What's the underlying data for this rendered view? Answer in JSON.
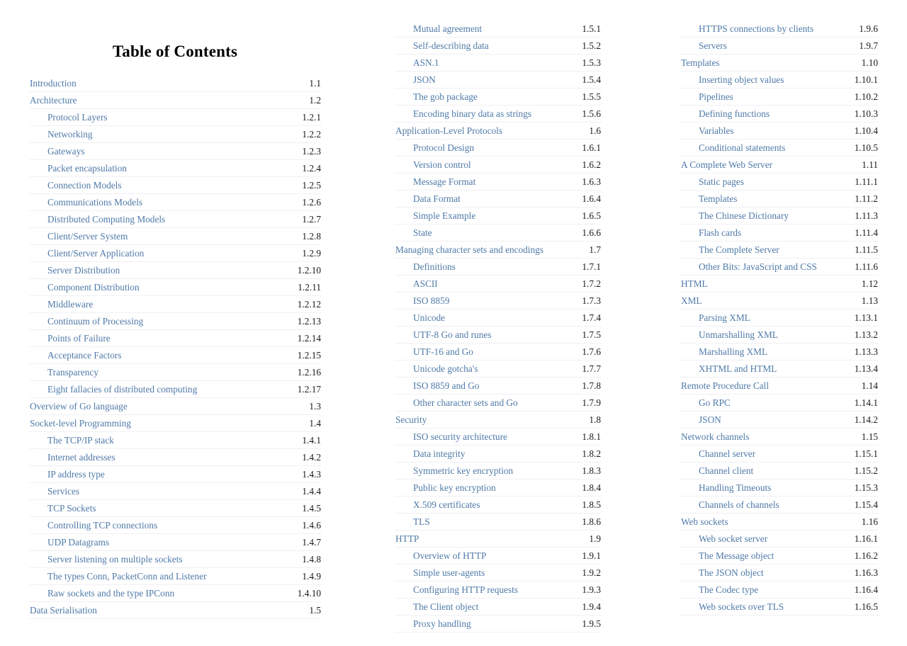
{
  "page": {
    "title": "Table of Contents",
    "link_color": "#4f7aa8",
    "number_color": "#1a1a1a",
    "rule_color": "#f1f1f4",
    "background": "#ffffff"
  },
  "columns": [
    {
      "id": "column-1",
      "has_title": true,
      "entries": [
        {
          "label": "Introduction",
          "number": "1.1",
          "level": 1
        },
        {
          "label": "Architecture",
          "number": "1.2",
          "level": 1
        },
        {
          "label": "Protocol Layers",
          "number": "1.2.1",
          "level": 2
        },
        {
          "label": "Networking",
          "number": "1.2.2",
          "level": 2
        },
        {
          "label": "Gateways",
          "number": "1.2.3",
          "level": 2
        },
        {
          "label": "Packet encapsulation",
          "number": "1.2.4",
          "level": 2
        },
        {
          "label": "Connection Models",
          "number": "1.2.5",
          "level": 2
        },
        {
          "label": "Communications Models",
          "number": "1.2.6",
          "level": 2
        },
        {
          "label": "Distributed Computing Models",
          "number": "1.2.7",
          "level": 2
        },
        {
          "label": "Client/Server System",
          "number": "1.2.8",
          "level": 2
        },
        {
          "label": "Client/Server Application",
          "number": "1.2.9",
          "level": 2
        },
        {
          "label": "Server Distribution",
          "number": "1.2.10",
          "level": 2
        },
        {
          "label": "Component Distribution",
          "number": "1.2.11",
          "level": 2
        },
        {
          "label": "Middleware",
          "number": "1.2.12",
          "level": 2
        },
        {
          "label": "Continuum of Processing",
          "number": "1.2.13",
          "level": 2
        },
        {
          "label": "Points of Failure",
          "number": "1.2.14",
          "level": 2
        },
        {
          "label": "Acceptance Factors",
          "number": "1.2.15",
          "level": 2
        },
        {
          "label": "Transparency",
          "number": "1.2.16",
          "level": 2
        },
        {
          "label": "Eight fallacies of distributed computing",
          "number": "1.2.17",
          "level": 2
        },
        {
          "label": "Overview of Go language",
          "number": "1.3",
          "level": 1
        },
        {
          "label": "Socket-level Programming",
          "number": "1.4",
          "level": 1
        },
        {
          "label": "The TCP/IP stack",
          "number": "1.4.1",
          "level": 2
        },
        {
          "label": "Internet addresses",
          "number": "1.4.2",
          "level": 2
        },
        {
          "label": "IP address type",
          "number": "1.4.3",
          "level": 2
        },
        {
          "label": "Services",
          "number": "1.4.4",
          "level": 2
        },
        {
          "label": "TCP Sockets",
          "number": "1.4.5",
          "level": 2
        },
        {
          "label": "Controlling TCP connections",
          "number": "1.4.6",
          "level": 2
        },
        {
          "label": "UDP Datagrams",
          "number": "1.4.7",
          "level": 2
        },
        {
          "label": "Server listening on multiple sockets",
          "number": "1.4.8",
          "level": 2
        },
        {
          "label": "The types Conn, PacketConn and Listener",
          "number": "1.4.9",
          "level": 2
        },
        {
          "label": "Raw sockets and the type IPConn",
          "number": "1.4.10",
          "level": 2
        },
        {
          "label": "Data Serialisation",
          "number": "1.5",
          "level": 1
        }
      ]
    },
    {
      "id": "column-2",
      "has_title": false,
      "entries": [
        {
          "label": "Mutual agreement",
          "number": "1.5.1",
          "level": 2
        },
        {
          "label": "Self-describing data",
          "number": "1.5.2",
          "level": 2
        },
        {
          "label": "ASN.1",
          "number": "1.5.3",
          "level": 2
        },
        {
          "label": "JSON",
          "number": "1.5.4",
          "level": 2
        },
        {
          "label": "The gob package",
          "number": "1.5.5",
          "level": 2
        },
        {
          "label": "Encoding binary data as strings",
          "number": "1.5.6",
          "level": 2
        },
        {
          "label": "Application-Level Protocols",
          "number": "1.6",
          "level": 1
        },
        {
          "label": "Protocol Design",
          "number": "1.6.1",
          "level": 2
        },
        {
          "label": "Version control",
          "number": "1.6.2",
          "level": 2
        },
        {
          "label": "Message Format",
          "number": "1.6.3",
          "level": 2
        },
        {
          "label": "Data Format",
          "number": "1.6.4",
          "level": 2
        },
        {
          "label": "Simple Example",
          "number": "1.6.5",
          "level": 2
        },
        {
          "label": "State",
          "number": "1.6.6",
          "level": 2
        },
        {
          "label": "Managing character sets and encodings",
          "number": "1.7",
          "level": 1
        },
        {
          "label": "Definitions",
          "number": "1.7.1",
          "level": 2
        },
        {
          "label": "ASCII",
          "number": "1.7.2",
          "level": 2
        },
        {
          "label": "ISO 8859",
          "number": "1.7.3",
          "level": 2
        },
        {
          "label": "Unicode",
          "number": "1.7.4",
          "level": 2
        },
        {
          "label": "UTF-8 Go and runes",
          "number": "1.7.5",
          "level": 2
        },
        {
          "label": "UTF-16 and Go",
          "number": "1.7.6",
          "level": 2
        },
        {
          "label": "Unicode gotcha's",
          "number": "1.7.7",
          "level": 2
        },
        {
          "label": "ISO 8859 and Go",
          "number": "1.7.8",
          "level": 2
        },
        {
          "label": "Other character sets and Go",
          "number": "1.7.9",
          "level": 2
        },
        {
          "label": "Security",
          "number": "1.8",
          "level": 1
        },
        {
          "label": "ISO security architecture",
          "number": "1.8.1",
          "level": 2
        },
        {
          "label": "Data integrity",
          "number": "1.8.2",
          "level": 2
        },
        {
          "label": "Symmetric key encryption",
          "number": "1.8.3",
          "level": 2
        },
        {
          "label": "Public key encryption",
          "number": "1.8.4",
          "level": 2
        },
        {
          "label": "X.509 certificates",
          "number": "1.8.5",
          "level": 2
        },
        {
          "label": "TLS",
          "number": "1.8.6",
          "level": 2
        },
        {
          "label": "HTTP",
          "number": "1.9",
          "level": 1
        },
        {
          "label": "Overview of HTTP",
          "number": "1.9.1",
          "level": 2
        },
        {
          "label": "Simple user-agents",
          "number": "1.9.2",
          "level": 2
        },
        {
          "label": "Configuring HTTP requests",
          "number": "1.9.3",
          "level": 2
        },
        {
          "label": "The Client object",
          "number": "1.9.4",
          "level": 2
        },
        {
          "label": "Proxy handling",
          "number": "1.9.5",
          "level": 2
        }
      ]
    },
    {
      "id": "column-3",
      "has_title": false,
      "entries": [
        {
          "label": "HTTPS connections by clients",
          "number": "1.9.6",
          "level": 2
        },
        {
          "label": "Servers",
          "number": "1.9.7",
          "level": 2
        },
        {
          "label": "Templates",
          "number": "1.10",
          "level": 1
        },
        {
          "label": "Inserting object values",
          "number": "1.10.1",
          "level": 2
        },
        {
          "label": "Pipelines",
          "number": "1.10.2",
          "level": 2
        },
        {
          "label": "Defining functions",
          "number": "1.10.3",
          "level": 2
        },
        {
          "label": "Variables",
          "number": "1.10.4",
          "level": 2
        },
        {
          "label": "Conditional statements",
          "number": "1.10.5",
          "level": 2
        },
        {
          "label": "A Complete Web Server",
          "number": "1.11",
          "level": 1
        },
        {
          "label": "Static pages",
          "number": "1.11.1",
          "level": 2
        },
        {
          "label": "Templates",
          "number": "1.11.2",
          "level": 2
        },
        {
          "label": "The Chinese Dictionary",
          "number": "1.11.3",
          "level": 2
        },
        {
          "label": "Flash cards",
          "number": "1.11.4",
          "level": 2
        },
        {
          "label": "The Complete Server",
          "number": "1.11.5",
          "level": 2
        },
        {
          "label": "Other Bits: JavaScript and CSS",
          "number": "1.11.6",
          "level": 2
        },
        {
          "label": "HTML",
          "number": "1.12",
          "level": 1
        },
        {
          "label": "XML",
          "number": "1.13",
          "level": 1
        },
        {
          "label": "Parsing XML",
          "number": "1.13.1",
          "level": 2
        },
        {
          "label": "Unmarshalling XML",
          "number": "1.13.2",
          "level": 2
        },
        {
          "label": "Marshalling XML",
          "number": "1.13.3",
          "level": 2
        },
        {
          "label": "XHTML and HTML",
          "number": "1.13.4",
          "level": 2
        },
        {
          "label": "Remote Procedure Call",
          "number": "1.14",
          "level": 1
        },
        {
          "label": "Go RPC",
          "number": "1.14.1",
          "level": 2
        },
        {
          "label": "JSON",
          "number": "1.14.2",
          "level": 2
        },
        {
          "label": "Network channels",
          "number": "1.15",
          "level": 1
        },
        {
          "label": "Channel server",
          "number": "1.15.1",
          "level": 2
        },
        {
          "label": "Channel client",
          "number": "1.15.2",
          "level": 2
        },
        {
          "label": "Handling Timeouts",
          "number": "1.15.3",
          "level": 2
        },
        {
          "label": "Channels of channels",
          "number": "1.15.4",
          "level": 2
        },
        {
          "label": "Web sockets",
          "number": "1.16",
          "level": 1
        },
        {
          "label": "Web socket server",
          "number": "1.16.1",
          "level": 2
        },
        {
          "label": "The Message object",
          "number": "1.16.2",
          "level": 2
        },
        {
          "label": "The JSON object",
          "number": "1.16.3",
          "level": 2
        },
        {
          "label": "The Codec type",
          "number": "1.16.4",
          "level": 2
        },
        {
          "label": "Web sockets over TLS",
          "number": "1.16.5",
          "level": 2
        }
      ]
    }
  ]
}
